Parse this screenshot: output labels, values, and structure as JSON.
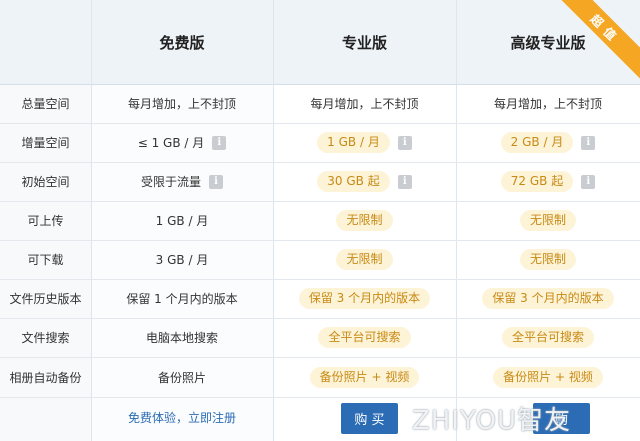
{
  "headers": {
    "free": "免费版",
    "pro": "专业版",
    "premium": "高级专业版",
    "badge": "超值"
  },
  "rows": [
    {
      "label": "总量空间",
      "free": "每月增加，上不封顶",
      "pro": "每月增加，上不封顶",
      "premium": "每月增加，上不封顶"
    },
    {
      "label": "增量空间",
      "free": "≤ 1 GB / 月",
      "pro": "1 GB / 月",
      "premium": "2 GB / 月"
    },
    {
      "label": "初始空间",
      "free": "受限于流量",
      "pro": "30 GB 起",
      "premium": "72 GB 起"
    },
    {
      "label": "可上传",
      "free": "1 GB / 月",
      "pro": "无限制",
      "premium": "无限制"
    },
    {
      "label": "可下载",
      "free": "3 GB / 月",
      "pro": "无限制",
      "premium": "无限制"
    },
    {
      "label": "文件历史版本",
      "free": "保留 1 个月内的版本",
      "pro": "保留 3 个月内的版本",
      "premium": "保留 3 个月内的版本"
    },
    {
      "label": "文件搜索",
      "free": "电脑本地搜索",
      "pro": "全平台可搜索",
      "premium": "全平台可搜索"
    },
    {
      "label": "相册自动备份",
      "free": "备份照片",
      "pro": "备份照片 + 视频",
      "premium": "备份照片 + 视频"
    }
  ],
  "info_icon": "i",
  "footer": {
    "free_link": "免费体验，立即注册",
    "pro_buy": "购 买",
    "premium_buy": "购"
  },
  "watermark": "ZHIYOU智友"
}
